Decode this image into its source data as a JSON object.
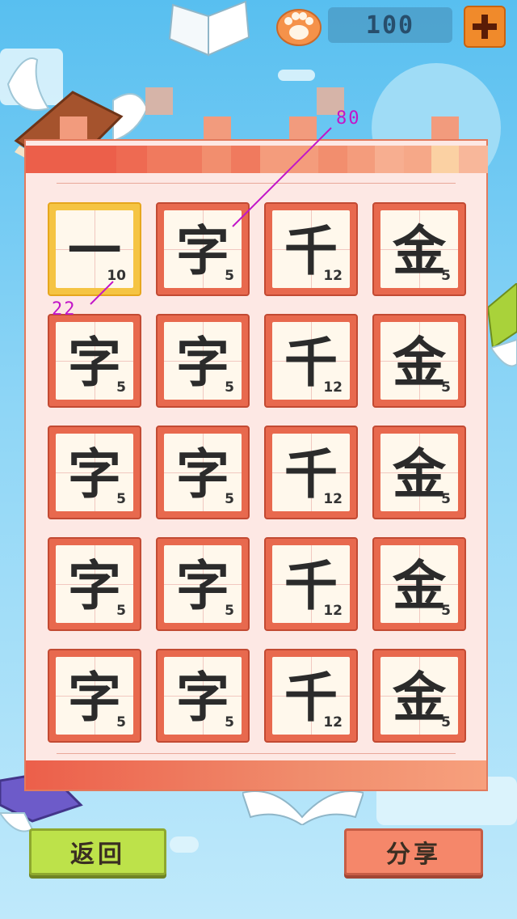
{
  "header": {
    "coin_value": "100",
    "paw_icon": "paw-icon",
    "add_icon": "plus-icon"
  },
  "tiles": [
    {
      "char": "一",
      "num": "10",
      "selected": true
    },
    {
      "char": "字",
      "num": "5"
    },
    {
      "char": "千",
      "num": "12"
    },
    {
      "char": "金",
      "num": "5"
    },
    {
      "char": "字",
      "num": "5"
    },
    {
      "char": "字",
      "num": "5"
    },
    {
      "char": "千",
      "num": "12"
    },
    {
      "char": "金",
      "num": "5"
    },
    {
      "char": "字",
      "num": "5"
    },
    {
      "char": "字",
      "num": "5"
    },
    {
      "char": "千",
      "num": "12"
    },
    {
      "char": "金",
      "num": "5"
    },
    {
      "char": "字",
      "num": "5"
    },
    {
      "char": "字",
      "num": "5"
    },
    {
      "char": "千",
      "num": "12"
    },
    {
      "char": "金",
      "num": "5"
    },
    {
      "char": "字",
      "num": "5"
    },
    {
      "char": "字",
      "num": "5"
    },
    {
      "char": "千",
      "num": "12"
    },
    {
      "char": "金",
      "num": "5"
    }
  ],
  "annotations": {
    "label_top": "80",
    "label_left": "22"
  },
  "buttons": {
    "back_label": "返回",
    "share_label": "分享"
  },
  "colors": {
    "accent": "#e8694e",
    "selected": "#f5c443",
    "back_button": "#bde24a",
    "share_button": "#f5876a",
    "annotation": "#c215c8"
  }
}
